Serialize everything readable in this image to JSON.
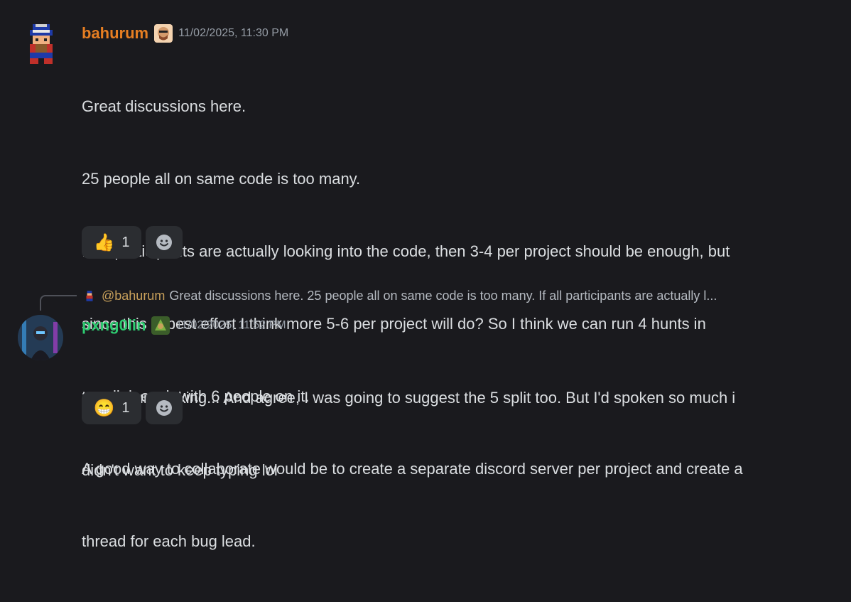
{
  "messages": [
    {
      "username": "bahurum",
      "username_color": "#e67e22",
      "timestamp": "11/02/2025, 11:30 PM",
      "lines": [
        "Great discussions here.",
        "25 people all on same code is too many.",
        "If all participants are actually looking into the code, then 3-4 per project should be enough, but",
        "since this is best effort I think more 5-6 per project will do? So I think we can run 4 hunts in",
        "parallel, each with 6 people on it.",
        "A good way to collaborate would be to create a separate discord server per project and create a",
        "thread for each bug lead."
      ],
      "reaction": {
        "emoji": "👍",
        "count": "1"
      },
      "add_reaction_icon": "smiley-add-icon"
    },
    {
      "reply": {
        "mention": "@bahurum",
        "text": "Great discussions here. 25 people all on same code is too many. If all participants are actually l..."
      },
      "username": "pxng0lin",
      "username_color": "#2ecc71",
      "timestamp": "11/02/2025, 11:52 PM",
      "lines": [
        "I like your thinking... And agree, I was going to suggest the 5 split too. But I'd spoken so much i",
        "didn't want to keep typing lol"
      ],
      "reaction": {
        "emoji": "😁",
        "count": "1"
      },
      "add_reaction_icon": "smiley-add-icon"
    }
  ]
}
